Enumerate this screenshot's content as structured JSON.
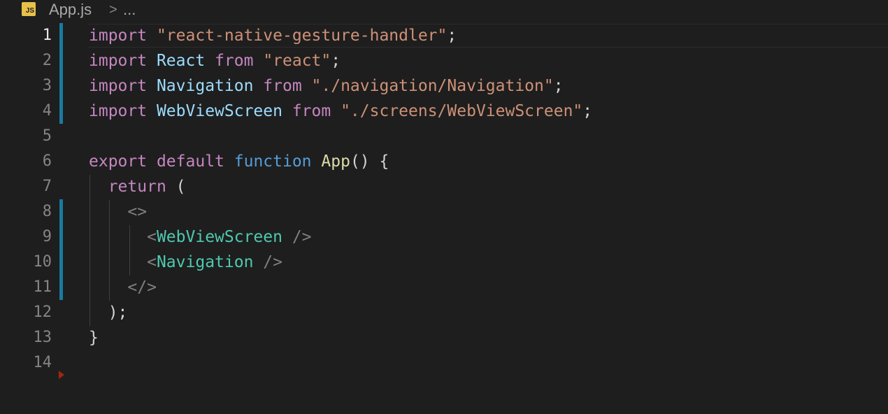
{
  "breadcrumb": {
    "icon_label": "JS",
    "file_name": "App.js",
    "separator": ">",
    "more": "..."
  },
  "editor": {
    "active_line": 1,
    "line_numbers": [
      "1",
      "2",
      "3",
      "4",
      "5",
      "6",
      "7",
      "8",
      "9",
      "10",
      "11",
      "12",
      "13",
      "14"
    ],
    "lines": [
      [
        {
          "t": "import",
          "c": "k"
        },
        {
          "t": " ",
          "c": "p"
        },
        {
          "t": "\"react-native-gesture-handler\"",
          "c": "s"
        },
        {
          "t": ";",
          "c": "p"
        }
      ],
      [
        {
          "t": "import",
          "c": "k"
        },
        {
          "t": " ",
          "c": "p"
        },
        {
          "t": "React",
          "c": "v"
        },
        {
          "t": " ",
          "c": "p"
        },
        {
          "t": "from",
          "c": "k"
        },
        {
          "t": " ",
          "c": "p"
        },
        {
          "t": "\"react\"",
          "c": "s"
        },
        {
          "t": ";",
          "c": "p"
        }
      ],
      [
        {
          "t": "import",
          "c": "k"
        },
        {
          "t": " ",
          "c": "p"
        },
        {
          "t": "Navigation",
          "c": "v"
        },
        {
          "t": " ",
          "c": "p"
        },
        {
          "t": "from",
          "c": "k"
        },
        {
          "t": " ",
          "c": "p"
        },
        {
          "t": "\"./navigation/Navigation\"",
          "c": "s"
        },
        {
          "t": ";",
          "c": "p"
        }
      ],
      [
        {
          "t": "import",
          "c": "k"
        },
        {
          "t": " ",
          "c": "p"
        },
        {
          "t": "WebViewScreen",
          "c": "v"
        },
        {
          "t": " ",
          "c": "p"
        },
        {
          "t": "from",
          "c": "k"
        },
        {
          "t": " ",
          "c": "p"
        },
        {
          "t": "\"./screens/WebViewScreen\"",
          "c": "s"
        },
        {
          "t": ";",
          "c": "p"
        }
      ],
      [],
      [
        {
          "t": "export",
          "c": "k"
        },
        {
          "t": " ",
          "c": "p"
        },
        {
          "t": "default",
          "c": "k"
        },
        {
          "t": " ",
          "c": "p"
        },
        {
          "t": "function",
          "c": "st"
        },
        {
          "t": " ",
          "c": "p"
        },
        {
          "t": "App",
          "c": "fn"
        },
        {
          "t": "() {",
          "c": "p"
        }
      ],
      [
        {
          "t": "  ",
          "c": "p"
        },
        {
          "t": "return",
          "c": "k"
        },
        {
          "t": " (",
          "c": "p"
        }
      ],
      [
        {
          "t": "    ",
          "c": "p"
        },
        {
          "t": "<>",
          "c": "pn"
        }
      ],
      [
        {
          "t": "      ",
          "c": "p"
        },
        {
          "t": "<",
          "c": "pn"
        },
        {
          "t": "WebViewScreen",
          "c": "tag"
        },
        {
          "t": " />",
          "c": "pn"
        }
      ],
      [
        {
          "t": "      ",
          "c": "p"
        },
        {
          "t": "<",
          "c": "pn"
        },
        {
          "t": "Navigation",
          "c": "tag"
        },
        {
          "t": " />",
          "c": "pn"
        }
      ],
      [
        {
          "t": "    ",
          "c": "p"
        },
        {
          "t": "</>",
          "c": "pn"
        }
      ],
      [
        {
          "t": "  );",
          "c": "p"
        }
      ],
      [
        {
          "t": "}",
          "c": "p"
        }
      ],
      []
    ],
    "git_modified_lines": [
      1,
      2,
      3,
      4,
      8,
      9,
      10,
      11
    ]
  },
  "colors": {
    "background": "#1e1e1e",
    "keyword": "#c586c0",
    "string": "#ce9178",
    "variable": "#9cdcfe",
    "function_name": "#dcdcaa",
    "storage": "#569cd6",
    "jsx_tag": "#4ec9b0",
    "git_modified": "#1a7aa0"
  }
}
